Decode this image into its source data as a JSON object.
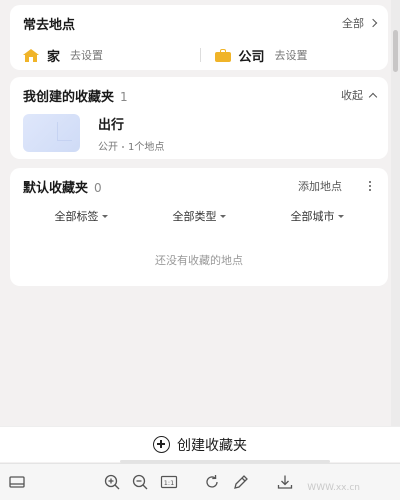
{
  "frequent": {
    "title": "常去地点",
    "all_link": "全部",
    "home": {
      "name": "家",
      "hint": "去设置"
    },
    "work": {
      "name": "公司",
      "hint": "去设置"
    }
  },
  "mine": {
    "title": "我创建的收藏夹",
    "count": "1",
    "collapse_link": "收起",
    "folders": [
      {
        "name": "出行",
        "visibility": "公开",
        "places": "1个地点"
      }
    ]
  },
  "default_folder": {
    "title": "默认收藏夹",
    "count": "0",
    "add_place": "添加地点",
    "filters": [
      "全部标签",
      "全部类型",
      "全部城市"
    ],
    "empty_text": "还没有收藏的地点"
  },
  "create_button": {
    "label": "创建收藏夹"
  },
  "toolbar": {
    "icons": [
      "panel-icon",
      "zoom-in-icon",
      "zoom-out-icon",
      "actual-size-icon",
      "rotate-icon",
      "edit-icon",
      "download-icon"
    ],
    "actual_size_label": "1:1"
  },
  "watermark": "WWW.xx.cn"
}
